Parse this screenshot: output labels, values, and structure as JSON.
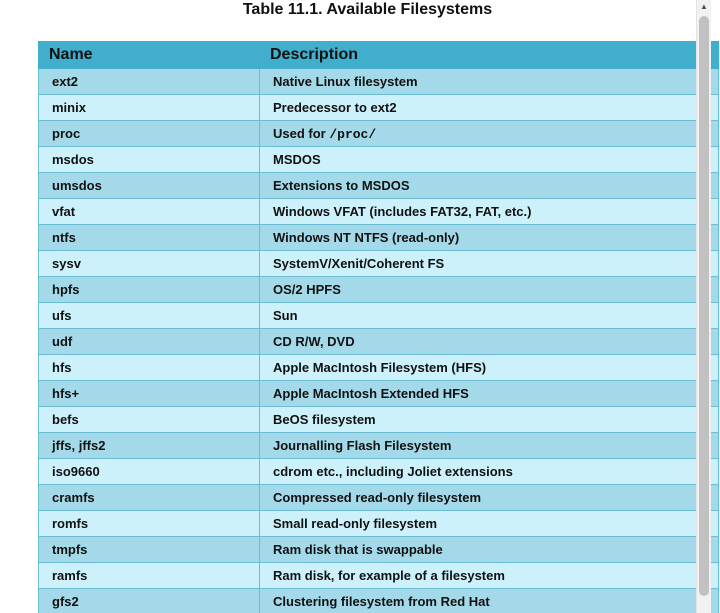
{
  "title": "Table 11.1. Available Filesystems",
  "headers": {
    "name": "Name",
    "description": "Description"
  },
  "rows": [
    {
      "name": "ext2",
      "description": "Native Linux filesystem"
    },
    {
      "name": "minix",
      "description": "Predecessor to ext2"
    },
    {
      "name": "proc",
      "description_prefix": "Used for ",
      "description_code": "/proc/"
    },
    {
      "name": "msdos",
      "description": "MSDOS"
    },
    {
      "name": "umsdos",
      "description": "Extensions to MSDOS"
    },
    {
      "name": "vfat",
      "description": "Windows VFAT (includes FAT32, FAT, etc.)"
    },
    {
      "name": "ntfs",
      "description": "Windows NT NTFS (read-only)"
    },
    {
      "name": "sysv",
      "description": "SystemV/Xenit/Coherent FS"
    },
    {
      "name": "hpfs",
      "description": "OS/2 HPFS"
    },
    {
      "name": "ufs",
      "description": "Sun"
    },
    {
      "name": "udf",
      "description": "CD R/W, DVD"
    },
    {
      "name": "hfs",
      "description": "Apple MacIntosh Filesystem (HFS)"
    },
    {
      "name": "hfs+",
      "description": "Apple MacIntosh Extended HFS"
    },
    {
      "name": "befs",
      "description": "BeOS filesystem"
    },
    {
      "name": "jffs, jffs2",
      "description": "Journalling Flash Filesystem"
    },
    {
      "name": "iso9660",
      "description": "cdrom etc., including Joliet extensions"
    },
    {
      "name": "cramfs",
      "description": "Compressed read-only filesystem"
    },
    {
      "name": "romfs",
      "description": "Small read-only filesystem"
    },
    {
      "name": "tmpfs",
      "description": "Ram disk that is swappable"
    },
    {
      "name": "ramfs",
      "description": "Ram disk, for example of a filesystem"
    },
    {
      "name": "gfs2",
      "description": "Clustering filesystem from Red Hat"
    }
  ],
  "colors": {
    "header_bg": "#42aecd",
    "row_odd_bg": "#a3d9e8",
    "row_even_bg": "#cdf1fb"
  },
  "icons": {
    "scroll_up": "triangle-up"
  }
}
